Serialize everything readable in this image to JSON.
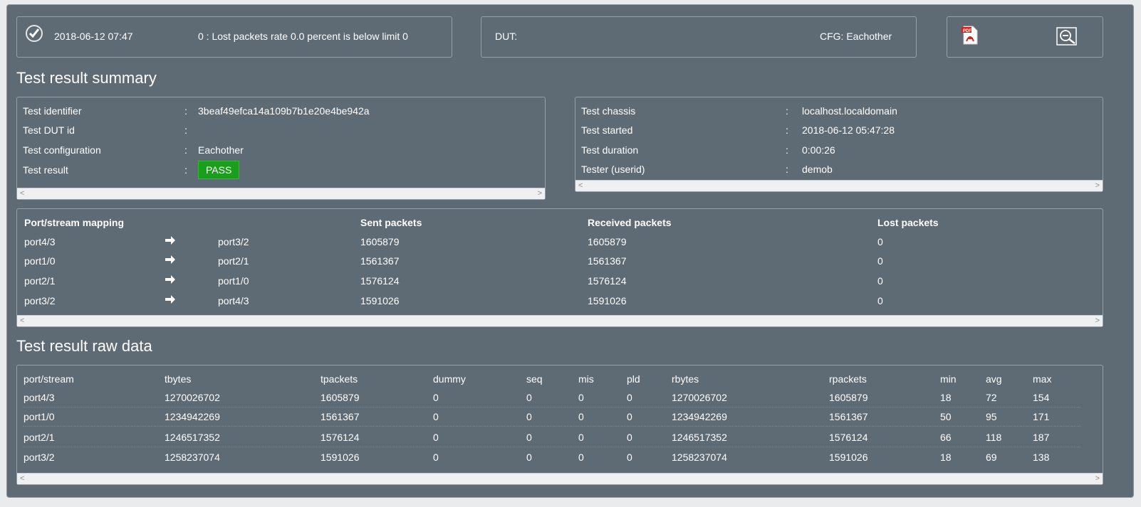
{
  "status_bar": {
    "timestamp": "2018-06-12 07:47",
    "message": "0 : Lost packets rate 0.0 percent is below limit 0",
    "dut_label": "DUT:",
    "cfg_label": "CFG: Eachother"
  },
  "icons": {
    "check": "check-circle-icon",
    "pdf": "pdf-icon",
    "zoom": "zoom-out-icon",
    "arrow": "right-arrow-icon"
  },
  "summary": {
    "title": "Test result summary",
    "left": [
      {
        "key": "Test identifier",
        "value": "3beaf49efca14a109b7b1e20e4be942a"
      },
      {
        "key": "Test DUT id",
        "value": ""
      },
      {
        "key": "Test configuration",
        "value": "Eachother"
      },
      {
        "key": "Test result",
        "value": "PASS"
      }
    ],
    "right": [
      {
        "key": "Test chassis",
        "value": "localhost.localdomain"
      },
      {
        "key": "Test started",
        "value": "2018-06-12 05:47:28"
      },
      {
        "key": "Test duration",
        "value": "0:00:26"
      },
      {
        "key": "Tester (userid)",
        "value": "demob"
      }
    ],
    "separator": ":"
  },
  "mapping": {
    "headers": {
      "mapping": "Port/stream mapping",
      "sent": "Sent packets",
      "received": "Received packets",
      "lost": "Lost packets"
    },
    "rows": [
      {
        "src": "port4/3",
        "dst": "port3/2",
        "sent": "1605879",
        "received": "1605879",
        "lost": "0"
      },
      {
        "src": "port1/0",
        "dst": "port2/1",
        "sent": "1561367",
        "received": "1561367",
        "lost": "0"
      },
      {
        "src": "port2/1",
        "dst": "port1/0",
        "sent": "1576124",
        "received": "1576124",
        "lost": "0"
      },
      {
        "src": "port3/2",
        "dst": "port4/3",
        "sent": "1591026",
        "received": "1591026",
        "lost": "0"
      }
    ]
  },
  "raw": {
    "title": "Test result raw data",
    "headers": [
      "port/stream",
      "tbytes",
      "tpackets",
      "dummy",
      "seq",
      "mis",
      "pld",
      "rbytes",
      "rpackets",
      "min",
      "avg",
      "max"
    ],
    "rows": [
      [
        "port4/3",
        "1270026702",
        "1605879",
        "0",
        "0",
        "0",
        "0",
        "1270026702",
        "1605879",
        "18",
        "72",
        "154"
      ],
      [
        "port1/0",
        "1234942269",
        "1561367",
        "0",
        "0",
        "0",
        "0",
        "1234942269",
        "1561367",
        "50",
        "95",
        "171"
      ],
      [
        "port2/1",
        "1246517352",
        "1576124",
        "0",
        "0",
        "0",
        "0",
        "1246517352",
        "1576124",
        "66",
        "118",
        "187"
      ],
      [
        "port3/2",
        "1258237074",
        "1591026",
        "0",
        "0",
        "0",
        "0",
        "1258237074",
        "1591026",
        "18",
        "69",
        "138"
      ]
    ]
  },
  "scroll": {
    "left": "<",
    "right": ">"
  },
  "colors": {
    "background": "#5e6b75",
    "pass": "#1b9e1b",
    "scrollbar": "#eef0f1"
  }
}
